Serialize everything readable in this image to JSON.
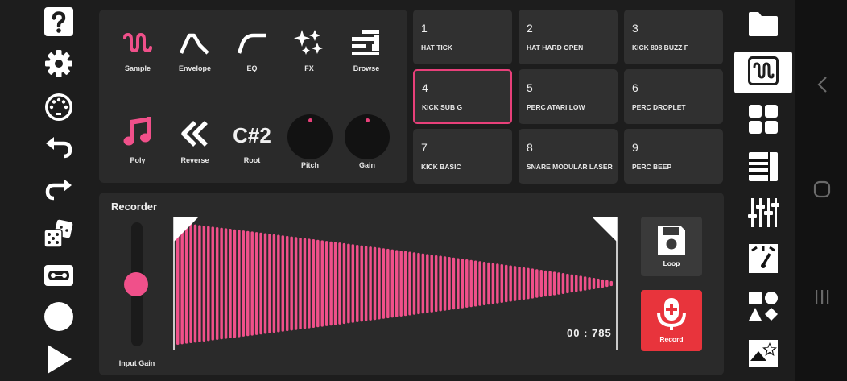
{
  "instrument": {
    "tools": [
      {
        "label": "Sample",
        "icon": "sample-wave-icon"
      },
      {
        "label": "Envelope",
        "icon": "envelope-icon"
      },
      {
        "label": "EQ",
        "icon": "eq-curve-icon"
      },
      {
        "label": "FX",
        "icon": "fx-sparkle-icon"
      },
      {
        "label": "Browse",
        "icon": "browse-icon"
      }
    ],
    "poly_label": "Poly",
    "reverse_label": "Reverse",
    "root_value": "C#2",
    "root_label": "Root",
    "pitch_label": "Pitch",
    "gain_label": "Gain"
  },
  "pads": [
    {
      "number": "1",
      "name": "HAT TICK"
    },
    {
      "number": "2",
      "name": "HAT HARD OPEN"
    },
    {
      "number": "3",
      "name": "KICK 808 BUZZ F"
    },
    {
      "number": "4",
      "name": "KICK SUB G",
      "selected": true
    },
    {
      "number": "5",
      "name": "PERC ATARI LOW"
    },
    {
      "number": "6",
      "name": "PERC DROPLET"
    },
    {
      "number": "7",
      "name": "KICK BASIC"
    },
    {
      "number": "8",
      "name": "SNARE MODULAR LASER"
    },
    {
      "number": "9",
      "name": "PERC BEEP"
    }
  ],
  "recorder": {
    "title": "Recorder",
    "input_gain_label": "Input Gain",
    "input_gain_level": 0.5,
    "time": "00 : 785",
    "loop_label": "Loop",
    "record_label": "Record"
  },
  "colors": {
    "accent": "#f0508a",
    "record": "#e8343c",
    "panel": "#2a2a2a",
    "pad": "#303030"
  },
  "left_toolbar": [
    "help-icon",
    "settings-gear-icon",
    "midi-icon",
    "undo-icon",
    "redo-icon",
    "dice-random-icon",
    "cassette-icon",
    "record-circle-icon",
    "play-icon"
  ],
  "right_toolbar": [
    "folder-icon",
    "sample-wave-icon",
    "pads-grid-icon",
    "keyboard-icon",
    "mixer-sliders-icon",
    "meter-icon",
    "shapes-icon",
    "image-star-icon"
  ]
}
